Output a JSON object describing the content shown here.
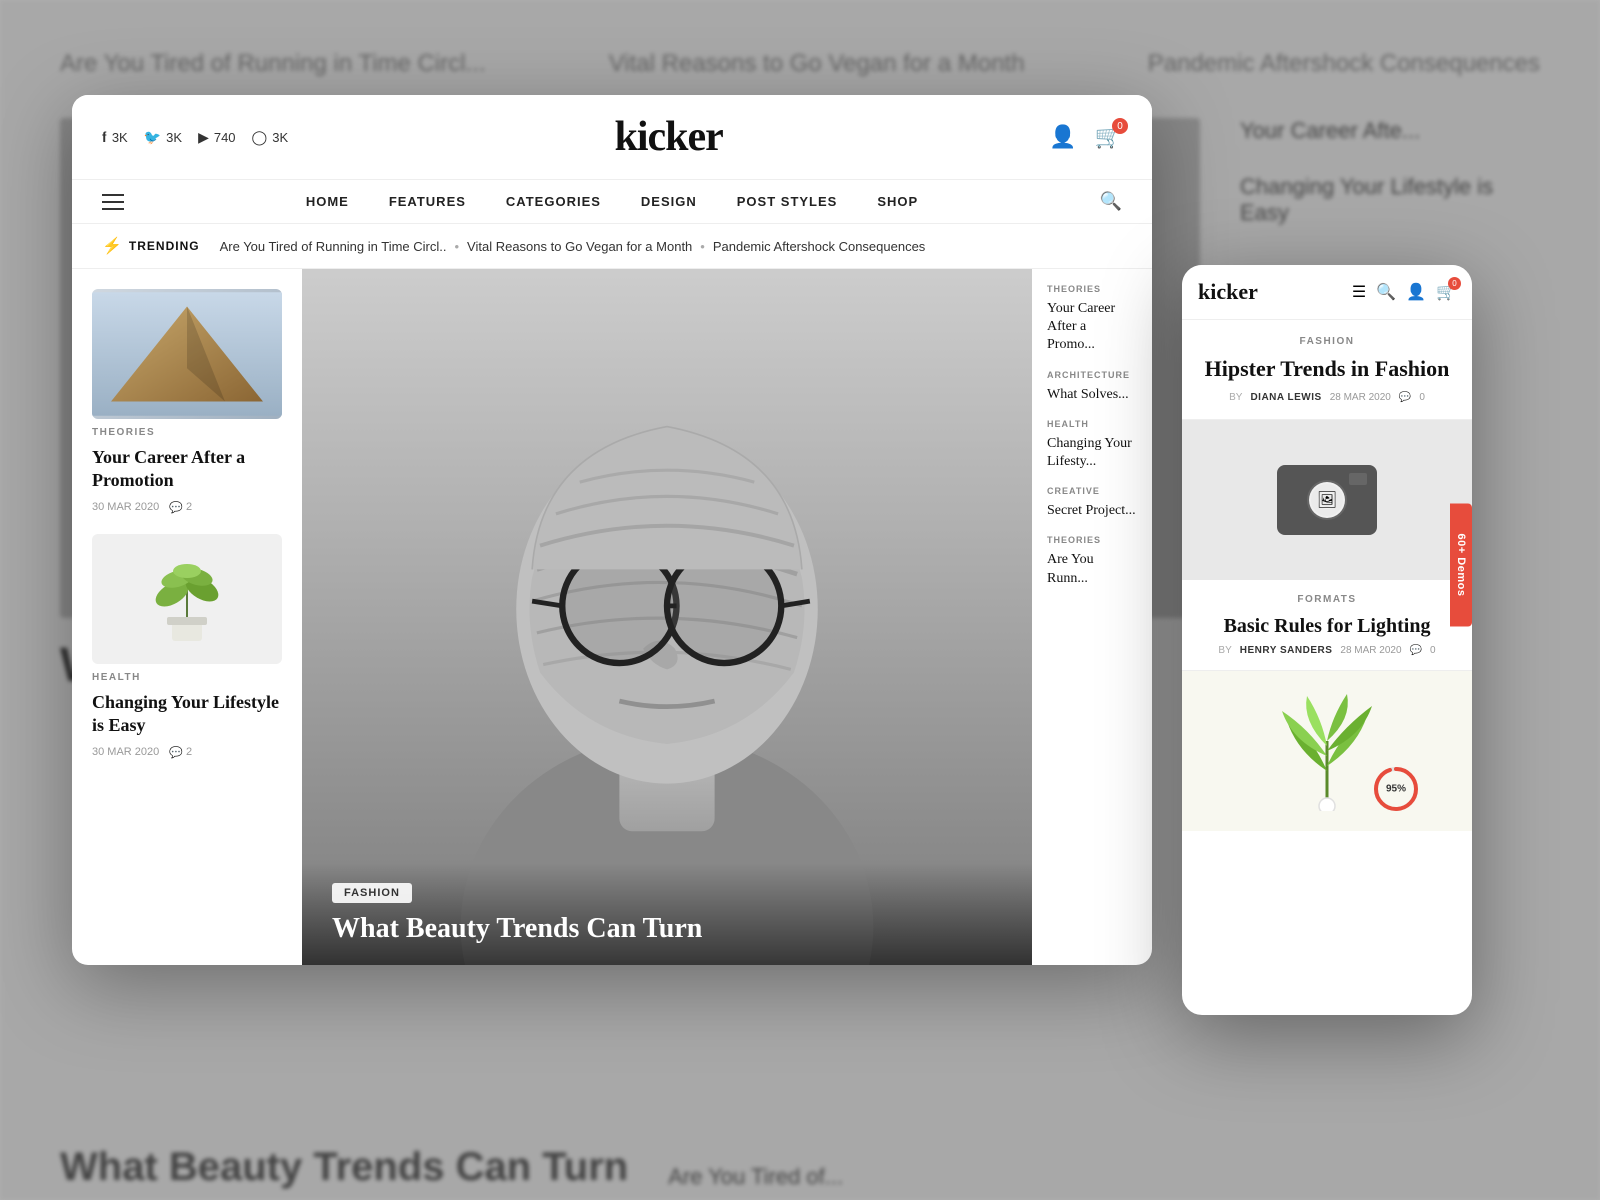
{
  "background": {
    "top_articles": [
      "Are You Tired of Running in Time Circl...",
      "Vital Reasons to Go Vegan for a Month",
      "Pandemic Aftershock Consequences"
    ],
    "bottom_title": "What Beauty Trends Can Turn",
    "side_right_title": "Your Career Afte...",
    "side_right2_title": "Changing Your Lifestyle is Easy",
    "side_right3_title": "Are You Tired of..."
  },
  "desktop": {
    "logo": "kicker",
    "social": [
      {
        "icon": "f",
        "count": "3K"
      },
      {
        "icon": "t",
        "count": "3K"
      },
      {
        "icon": "▶",
        "count": "740"
      },
      {
        "icon": "◯",
        "count": "3K"
      }
    ],
    "cart_count": "0",
    "nav_items": [
      "HOME",
      "FEATURES",
      "CATEGORIES",
      "DESIGN",
      "POST STYLES",
      "SHOP"
    ],
    "trending_label": "TRENDING",
    "trending_items": [
      "Are You Tired of Running in Time Circl..",
      "Vital Reasons to Go Vegan for a Month",
      "Pandemic Aftershock Consequences"
    ],
    "left_articles": [
      {
        "category": "THEORIES",
        "title": "Your Career After a Promotion",
        "date": "30 MAR 2020",
        "comments": "2",
        "image_type": "triangle"
      },
      {
        "category": "HEALTH",
        "title": "Changing Your Lifestyle is Easy",
        "date": "30 MAR 2020",
        "comments": "2",
        "image_type": "plant"
      }
    ],
    "featured": {
      "category": "FASHION",
      "title": "What Beauty Trends Can Turn"
    },
    "right_articles": [
      {
        "category": "THEORIES",
        "title": "Your Career After a Promo..."
      },
      {
        "category": "ARCHITECTURE",
        "title": "What Solves..."
      },
      {
        "category": "HEALTH",
        "title": "Changing Your Lifesty..."
      },
      {
        "category": "CREATIVE",
        "title": "Secret Project..."
      },
      {
        "category": "THEORIES",
        "title": "Are You Runn..."
      }
    ]
  },
  "mobile": {
    "logo": "kicker",
    "cart_count": "0",
    "featured": {
      "category": "FASHION",
      "title": "Hipster Trends in Fashion",
      "author": "DIANA LEWIS",
      "date": "28 MAR 2020",
      "comments": "0"
    },
    "camera_article": {
      "category": "FORMATS",
      "title": "Basic Rules for Lighting",
      "author": "HENRY SANDERS",
      "date": "28 MAR 2020",
      "comments": "0"
    },
    "plant_article": {
      "progress": "95%"
    },
    "demos_tab": "60+ Demos"
  }
}
